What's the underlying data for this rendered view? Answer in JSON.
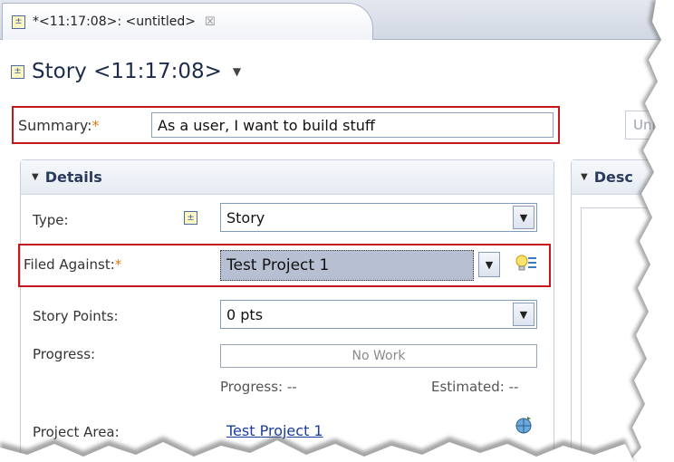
{
  "tab": {
    "title": "*<11:17:08>: <untitled>",
    "close": "☒"
  },
  "header": {
    "title": "Story <11:17:08>",
    "menu_arrow": "▼"
  },
  "summary": {
    "label": "Summary:",
    "required": "*",
    "value": "As a user, I want to build stuff",
    "side_field": "Uni"
  },
  "details": {
    "title": "Details",
    "type": {
      "label": "Type:",
      "value": "Story"
    },
    "filed_against": {
      "label": "Filed Against:",
      "required": "*",
      "value": "Test Project 1"
    },
    "story_points": {
      "label": "Story Points:",
      "value": "0 pts"
    },
    "progress": {
      "label": "Progress:",
      "bar_text": "No Work",
      "progress_text": "Progress: --",
      "estimated_text": "Estimated: --"
    },
    "project_area": {
      "label": "Project Area:",
      "value": "Test Project 1"
    }
  },
  "description": {
    "title": "Desc"
  },
  "colors": {
    "highlight": "#c6161e",
    "required": "#e07a12",
    "link": "#1a3ca0"
  }
}
